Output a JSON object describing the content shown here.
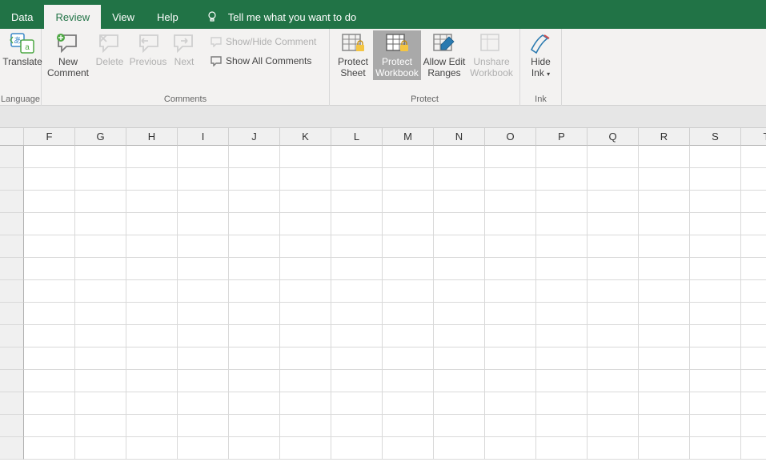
{
  "tabs": {
    "data": "Data",
    "review": "Review",
    "view": "View",
    "help": "Help",
    "tellme": "Tell me what you want to do"
  },
  "ribbon": {
    "language": {
      "translate": "Translate",
      "group": "Language"
    },
    "comments": {
      "new": "New Comment",
      "delete": "Delete",
      "previous": "Previous",
      "next": "Next",
      "showhide": "Show/Hide Comment",
      "showall": "Show All Comments",
      "group": "Comments"
    },
    "protect": {
      "sheet": "Protect Sheet",
      "workbook": "Protect Workbook",
      "ranges": "Allow Edit Ranges",
      "unshare": "Unshare Workbook",
      "group": "Protect"
    },
    "ink": {
      "hide": "Hide Ink",
      "group": "Ink"
    }
  },
  "columns": [
    "F",
    "G",
    "H",
    "I",
    "J",
    "K",
    "L",
    "M",
    "N",
    "O",
    "P",
    "Q",
    "R",
    "S",
    "T"
  ]
}
